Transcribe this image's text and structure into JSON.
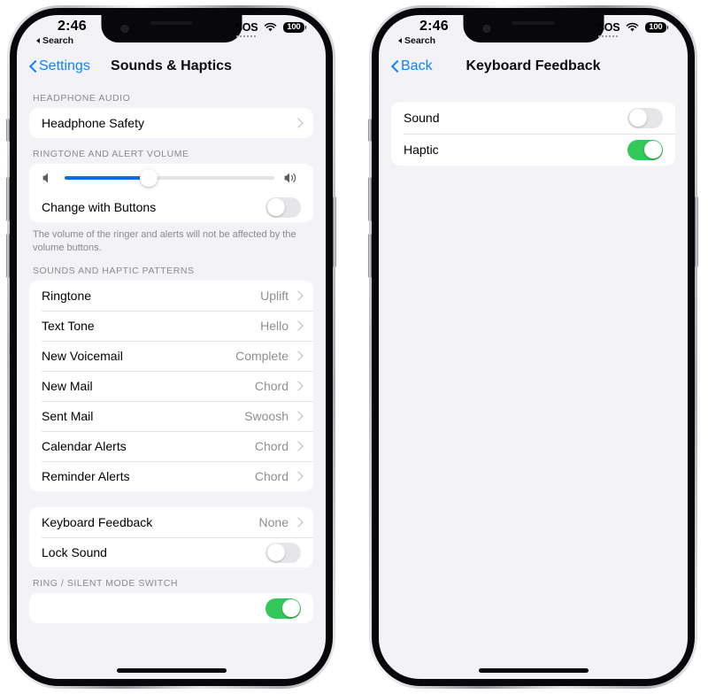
{
  "status_bar": {
    "time": "2:46",
    "back_to_app": "Search",
    "sos": "SOS",
    "wifi_icon": "wifi-icon",
    "battery": "100"
  },
  "left_phone": {
    "nav": {
      "back_label": "Settings",
      "title": "Sounds & Haptics"
    },
    "sections": [
      {
        "header": "HEADPHONE AUDIO",
        "rows": [
          {
            "label": "Headphone Safety",
            "value": "",
            "type": "disclosure"
          }
        ]
      },
      {
        "header": "RINGTONE AND ALERT VOLUME",
        "slider": {
          "percent": 40,
          "left_icon": "speaker-mute-icon",
          "right_icon": "speaker-loud-icon"
        },
        "rows": [
          {
            "label": "Change with Buttons",
            "type": "toggle",
            "on": false
          }
        ],
        "footnote": "The volume of the ringer and alerts will not be affected by the volume buttons."
      },
      {
        "header": "SOUNDS AND HAPTIC PATTERNS",
        "rows": [
          {
            "label": "Ringtone",
            "value": "Uplift",
            "type": "disclosure"
          },
          {
            "label": "Text Tone",
            "value": "Hello",
            "type": "disclosure"
          },
          {
            "label": "New Voicemail",
            "value": "Complete",
            "type": "disclosure"
          },
          {
            "label": "New Mail",
            "value": "Chord",
            "type": "disclosure"
          },
          {
            "label": "Sent Mail",
            "value": "Swoosh",
            "type": "disclosure"
          },
          {
            "label": "Calendar Alerts",
            "value": "Chord",
            "type": "disclosure"
          },
          {
            "label": "Reminder Alerts",
            "value": "Chord",
            "type": "disclosure"
          }
        ]
      },
      {
        "header": "",
        "rows": [
          {
            "label": "Keyboard Feedback",
            "value": "None",
            "type": "disclosure"
          },
          {
            "label": "Lock Sound",
            "type": "toggle",
            "on": false
          }
        ]
      },
      {
        "header": "RING / SILENT MODE SWITCH",
        "rows": [
          {
            "label": "",
            "type": "toggle",
            "on": true
          }
        ]
      }
    ]
  },
  "right_phone": {
    "nav": {
      "back_label": "Back",
      "title": "Keyboard Feedback"
    },
    "sections": [
      {
        "header": "",
        "rows": [
          {
            "label": "Sound",
            "type": "toggle",
            "on": false
          },
          {
            "label": "Haptic",
            "type": "toggle",
            "on": true
          }
        ]
      }
    ]
  },
  "colors": {
    "accent_blue": "#0a84ff",
    "slider_blue": "#0a70e0",
    "toggle_green": "#34c759",
    "toggle_off": "#e6e6ea",
    "screen_bg": "#f2f2f7",
    "card_bg": "#ffffff",
    "secondary_text": "#8e8e93"
  }
}
